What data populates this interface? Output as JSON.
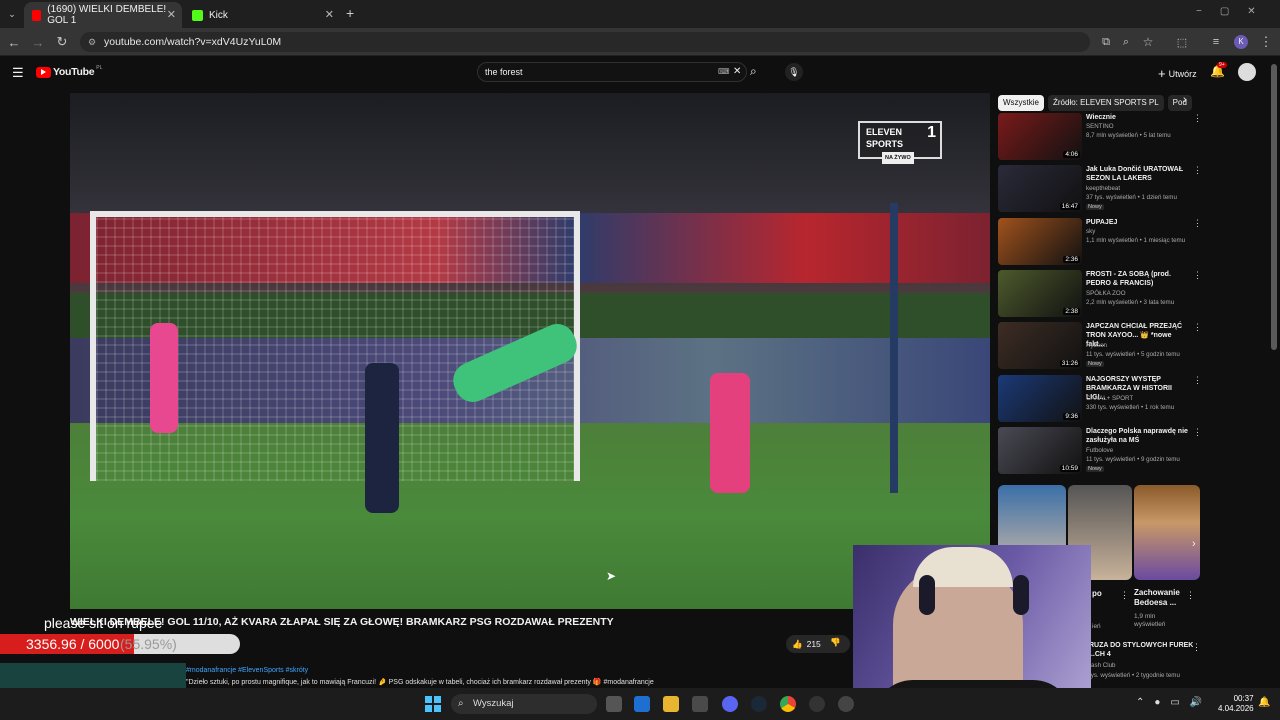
{
  "browser": {
    "tabs": [
      {
        "title": "(1690) WIELKI DEMBELE! GOL 1",
        "favicon_color": "#ff0000"
      },
      {
        "title": "Kick",
        "favicon_color": "#53fc18"
      }
    ],
    "url": "youtube.com/watch?v=xdV4UzYuL0M",
    "new_tab": "+",
    "profile_initial": "K"
  },
  "youtube": {
    "logo": "YouTube",
    "region": "PL",
    "search_value": "the forest",
    "create_label": "Utwórz",
    "notif_count": "9+"
  },
  "video": {
    "channel_bug": "ELEVEN SPORTS",
    "channel_bug_num": "1",
    "channel_bug_sub": "NA ŻYWO",
    "title": "WIELKI DEMBELE! GOL 11/10, AŻ KVARA ZŁAPAŁ SIĘ ZA GŁOWĘ! BRAMKARZ PSG ROZDAWAŁ PREZENTY",
    "likes": "215",
    "desc_tags": "#modanafrancje #ElevenSports #skróty",
    "desc_text": "\"Dzieło sztuki, po prostu magnifique, jak to mawiają Francuzi! 🤌 PSG odskakuje w tabeli, chociaż ich bramkarz rozdawał prezenty 🎁 #modanafrancje"
  },
  "sidebar": {
    "chips": [
      "Wszystkie",
      "Źródło: ELEVEN SPORTS PL",
      "Pod"
    ],
    "recs": [
      {
        "title": "Wiecznie",
        "channel": "SENTINO",
        "meta": "8,7 mln wyświetleń • 5 lat temu",
        "duration": "4:06",
        "thumb": "#7a1a1a",
        "badge": ""
      },
      {
        "title": "Jak Luka Dončić URATOWAŁ SEZON LA LAKERS",
        "channel": "keepthebeat",
        "meta": "37 tys. wyświetleń • 1 dzień temu",
        "duration": "16:47",
        "thumb": "#2a2a3a",
        "badge": "Nowy"
      },
      {
        "title": "PUPAJEJ",
        "channel": "sky",
        "meta": "1,1 mln wyświetleń • 1 miesiąc temu",
        "duration": "2:36",
        "thumb": "#a0521c",
        "badge": ""
      },
      {
        "title": "FROSTI - ZA SOBĄ (prod. PEDRO & FRANCIS)",
        "channel": "SPÓŁKA ZOO",
        "meta": "2,2 mln wyświetleń • 3 lata temu",
        "duration": "2:38",
        "thumb": "#4d5a2c",
        "badge": ""
      },
      {
        "title": "JAPCZAN CHCIAŁ PRZEJĄĆ TRON XAYOO... 👑 *nowe fakt...",
        "channel": "Rybson",
        "meta": "11 tys. wyświetleń • 5 godzin temu",
        "duration": "31:26",
        "thumb": "#3d2d24",
        "badge": "Nowy"
      },
      {
        "title": "NAJGORSZY WYSTĘP BRAMKARZA W HISTORII LIGI...",
        "channel": "CANAL+ SPORT",
        "meta": "330 tys. wyświetleń • 1 rok temu",
        "duration": "9:36",
        "thumb": "#1b3a78",
        "badge": ""
      },
      {
        "title": "Dlaczego Polska naprawdę nie zasłużyła na MŚ",
        "channel": "Futbolove",
        "meta": "11 tys. wyświetleń • 9 godzin temu",
        "duration": "10:59",
        "thumb": "#4a4a55",
        "badge": "Nowy"
      }
    ],
    "short_title": "Zachowanie Bedoesa ...",
    "short_views": "1,9 mln wyświetleń",
    "partial_title": "po",
    "partial_views": "ień",
    "last_title": "RUZA DO STYLOWYCH FUREK ...CH 4",
    "last_channel": "rash Club",
    "last_meta": "tys. wyświetleń • 2 tygodnie temu"
  },
  "overlay": {
    "message": "please sit on rupee",
    "progress_text": "3356.96 / 6000",
    "progress_pct_text": "(55.95%)",
    "progress_fraction": 0.5595
  },
  "taskbar": {
    "search_placeholder": "Wyszukaj",
    "time": "00:37",
    "date": "4.04.2026"
  }
}
